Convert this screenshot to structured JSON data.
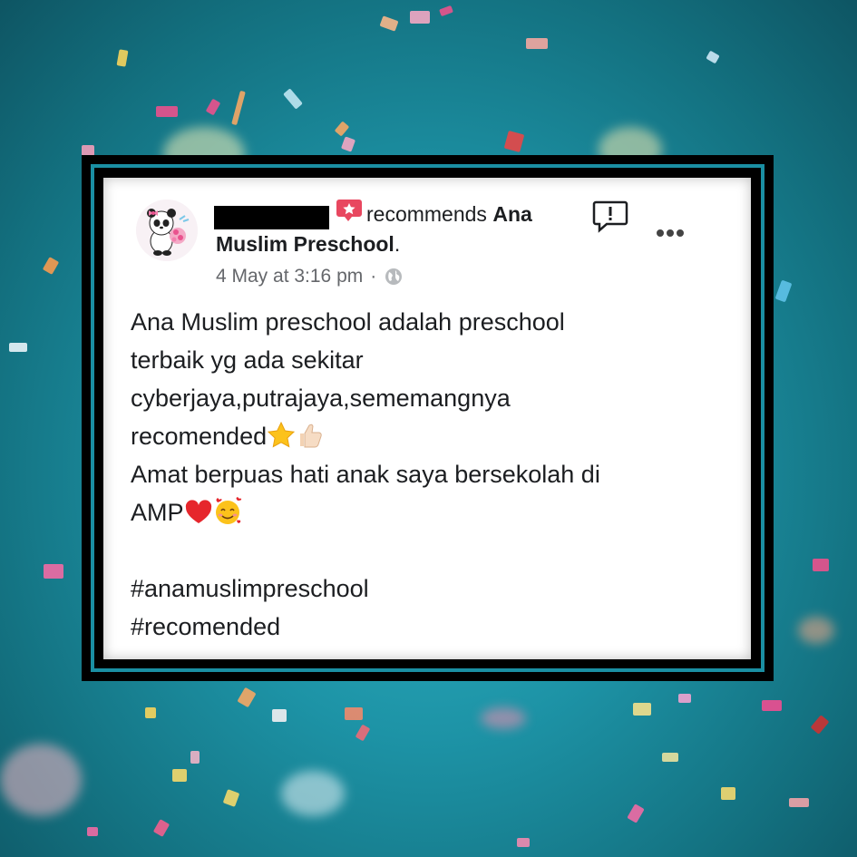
{
  "post": {
    "action_text": "recommends",
    "page_name_part1": "Ana",
    "page_name_part2": "Muslim Preschool",
    "period": ".",
    "timestamp": "4 May at 3:16 pm",
    "separator": "·",
    "privacy_icon": "globe-icon",
    "recommend_icon": "recommend-badge-icon",
    "lines": [
      "Ana Muslim preschool adalah preschool",
      "terbaik yg ada sekitar",
      "cyberjaya,putrajaya,sememangnya",
      "recomended",
      "Amat berpuas hati anak saya bersekolah di",
      "AMP"
    ],
    "hashtags": [
      "#anamuslimpreschool",
      "#recomended"
    ]
  },
  "colors": {
    "background": "#1d93a6",
    "frame": "#000000",
    "frame_accent": "#1a8fa3",
    "recommend_badge": "#e8475f",
    "text": "#1c1e21",
    "meta_text": "#65676b"
  }
}
